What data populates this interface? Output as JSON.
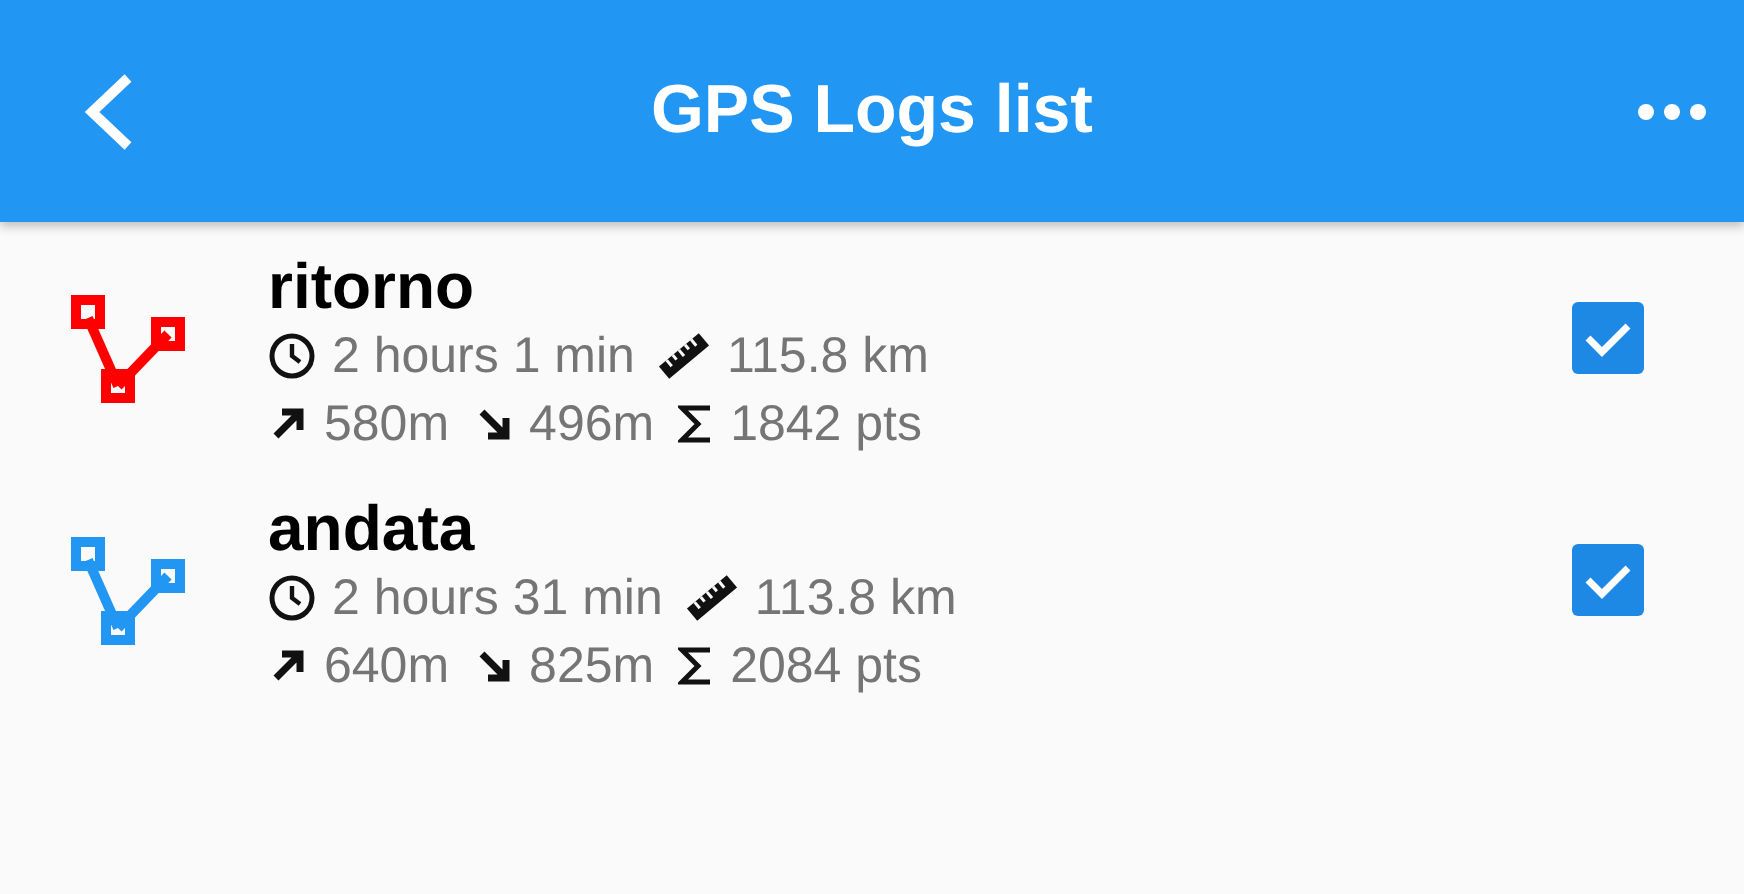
{
  "app_bar": {
    "title": "GPS Logs list"
  },
  "logs": [
    {
      "name": "ritorno",
      "color": "#ff0000",
      "duration": "2 hours 1 min",
      "distance": "115.8 km",
      "up": "580m",
      "down": "496m",
      "points": "1842 pts",
      "checked": true
    },
    {
      "name": "andata",
      "color": "#2196f3",
      "duration": "2 hours 31 min",
      "distance": "113.8 km",
      "up": "640m",
      "down": "825m",
      "points": "2084 pts",
      "checked": true
    }
  ]
}
